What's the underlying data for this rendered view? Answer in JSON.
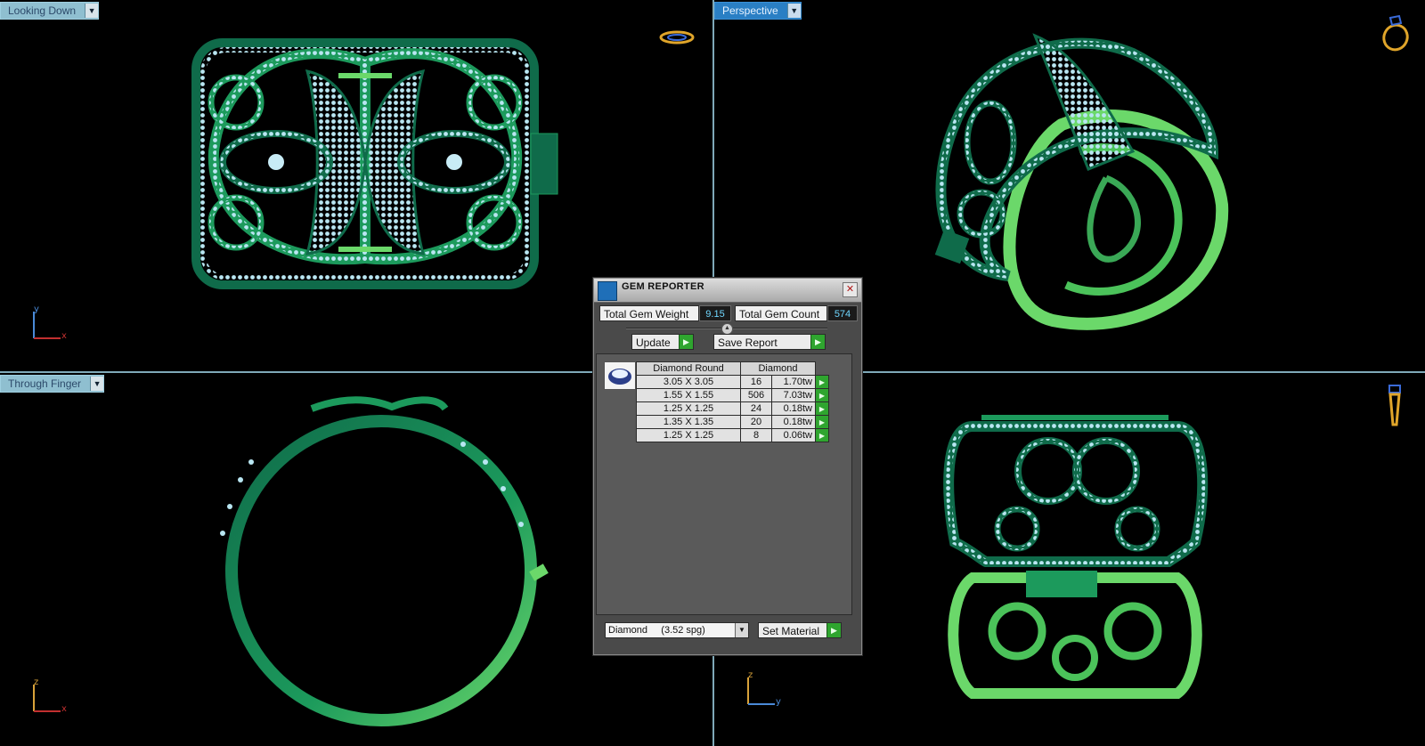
{
  "viewports": {
    "top_left": {
      "label": "Looking Down",
      "axis_v": "y",
      "axis_h": "x"
    },
    "top_right": {
      "label": "Perspective"
    },
    "bottom_left": {
      "label": "Through Finger",
      "axis_v": "z",
      "axis_h": "x"
    },
    "bottom_right": {
      "axis_v": "z",
      "axis_h": "y"
    }
  },
  "gem_reporter": {
    "title": "GEM REPORTER",
    "close_glyph": "✕",
    "total_weight_label": "Total Gem Weight",
    "total_weight_value": "9.15",
    "total_count_label": "Total Gem Count",
    "total_count_value": "574",
    "update_label": "Update",
    "save_report_label": "Save Report",
    "table": {
      "headers": [
        "Diamond Round",
        "Diamond"
      ],
      "rows": [
        {
          "size": "3.05 X 3.05",
          "count": "16",
          "weight": "1.70tw"
        },
        {
          "size": "1.55 X 1.55",
          "count": "506",
          "weight": "7.03tw"
        },
        {
          "size": "1.25 X 1.25",
          "count": "24",
          "weight": "0.18tw"
        },
        {
          "size": "1.35 X 1.35",
          "count": "20",
          "weight": "0.18tw"
        },
        {
          "size": "1.25 X 1.25",
          "count": "8",
          "weight": "0.06tw"
        }
      ]
    },
    "material_value": "Diamond     (3.52 spg)",
    "set_material_label": "Set Material"
  },
  "colors": {
    "metal_dark": "#0f6b4a",
    "metal_mid": "#1c9a5c",
    "metal_light": "#6bd86a",
    "gem": "#b9e6f2",
    "viewport_divider": "#7fa9b8",
    "active_label": "#2a7fc4"
  },
  "icons": {
    "ring_nav": "ring-orientation-icon",
    "dropdown": "chevron-down-icon",
    "go": "play-arrow-icon"
  }
}
